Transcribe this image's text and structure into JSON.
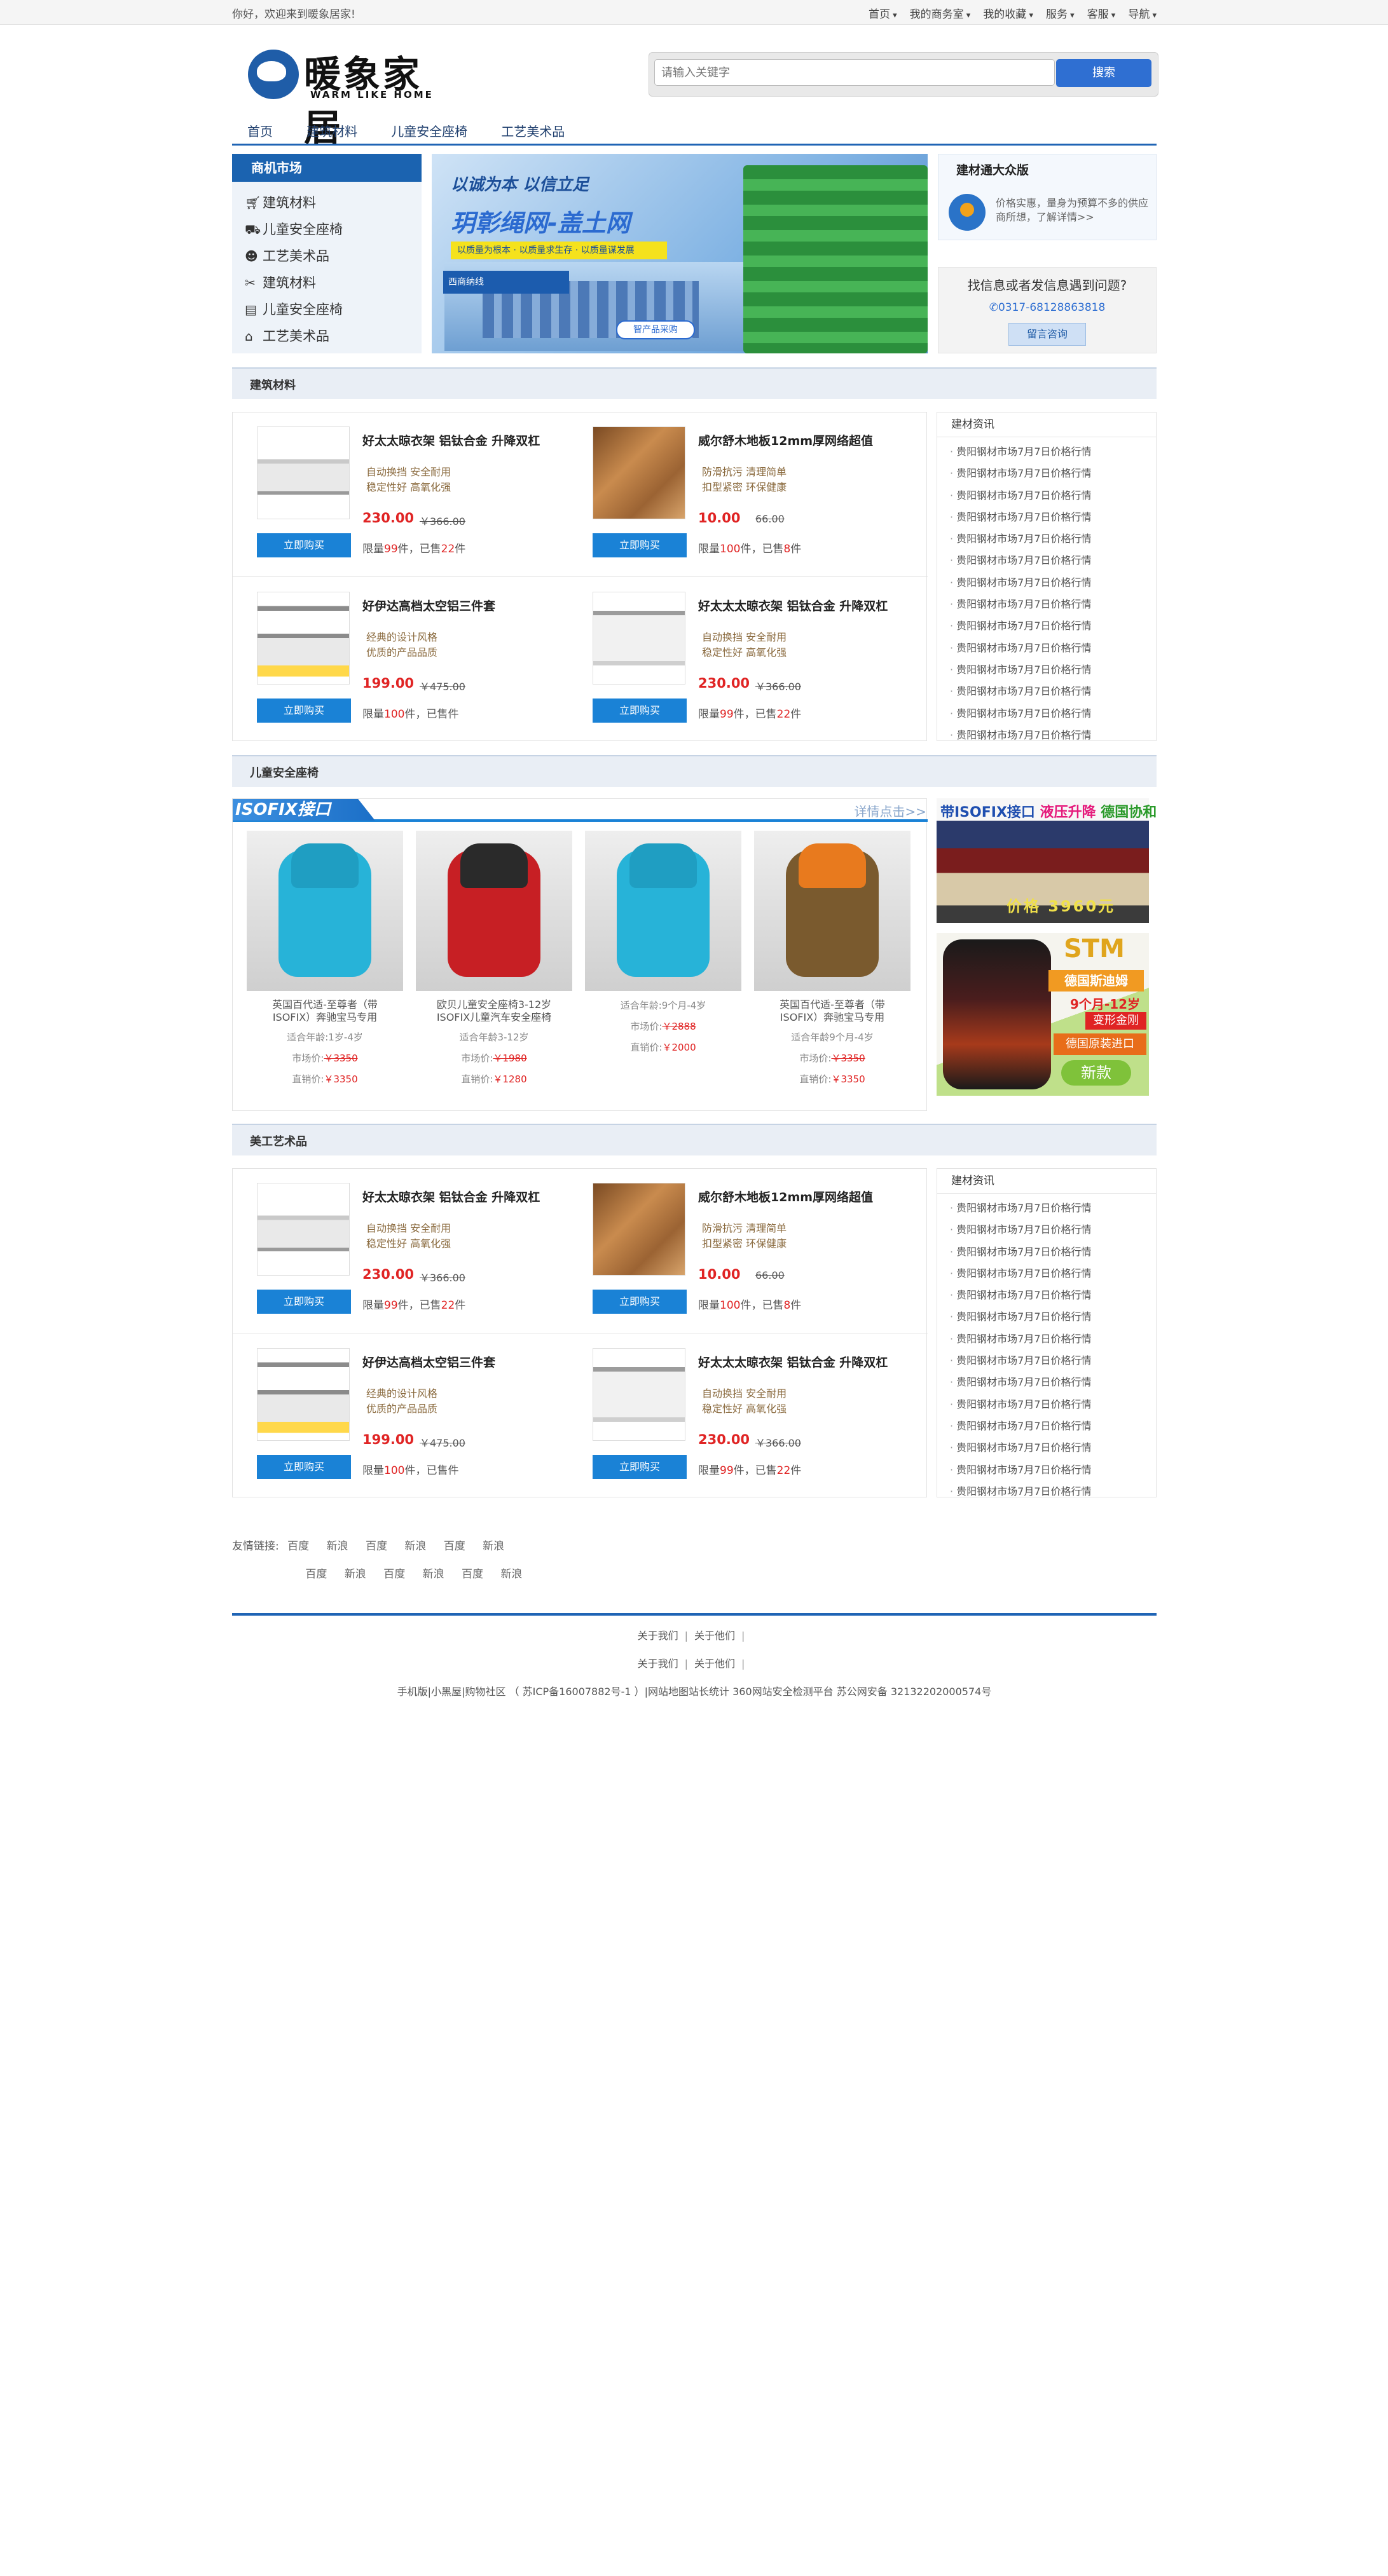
{
  "topbar": {
    "welcome": "你好，欢迎来到暖象居家!",
    "menu": [
      "首页",
      "我的商务室",
      "我的收藏",
      "服务",
      "客服",
      "导航"
    ]
  },
  "logo": {
    "cn": "暖象家居",
    "en": "WARM LIKE HOME"
  },
  "search": {
    "placeholder": "请输入关键字",
    "button": "搜索"
  },
  "nav": [
    "首页",
    "建筑材料",
    "儿童安全座椅",
    "工艺美术品"
  ],
  "categories": {
    "title": "商机市场",
    "items": [
      {
        "icon": "cart-icon",
        "label": "建筑材料"
      },
      {
        "icon": "car-icon",
        "label": "儿童安全座椅"
      },
      {
        "icon": "people-icon",
        "label": "工艺美术品"
      },
      {
        "icon": "tools-icon",
        "label": "建筑材料"
      },
      {
        "icon": "document-icon",
        "label": "儿童安全座椅"
      },
      {
        "icon": "building-icon",
        "label": "工艺美术品"
      }
    ]
  },
  "banner": {
    "slogan": "以诚为本 以信立足",
    "headline": "玥彰绳网-盖土网",
    "tagline": "以质量为根本 · 以质量求生存 · 以质量谋发展",
    "tag": "西商纳线",
    "button": "智产品采购"
  },
  "side": {
    "title": "建材通大众版",
    "desc": "价格实惠，量身为预算不多的供应商所想，了解详情>>",
    "question": "找信息或者发信息遇到问题?",
    "phone": "0317-68128863818",
    "message_button": "留言咨询"
  },
  "sections": {
    "building": "建筑材料",
    "seats": "儿童安全座椅",
    "art": "美工艺术品"
  },
  "products": [
    {
      "name": "好太太晾衣架  铝钛合金  升降双杠",
      "f1": "自动换挡    安全耐用",
      "f2": "稳定性好    高氧化强",
      "price": "230.00",
      "old": "￥366.00",
      "limit_pre": "限量",
      "limit_n": "99",
      "limit_mid": "件，已售",
      "sold": "22",
      "limit_end": "件",
      "buy": "立即购买",
      "img": "rack"
    },
    {
      "name": "威尔舒木地板12mm厚网络超值",
      "f1": "防滑抗污    清理简单",
      "f2": "扣型紧密    环保健康",
      "price": "10.00",
      "old": "66.00",
      "limit_pre": "限量",
      "limit_n": "100",
      "limit_mid": "件，已售",
      "sold": "8",
      "limit_end": "件",
      "buy": "立即购买",
      "img": "floor"
    },
    {
      "name": "好伊达高档太空铝三件套",
      "f1": "经典的设计风格",
      "f2": "优质的产品品质",
      "price": "199.00",
      "old": "￥475.00",
      "limit_pre": "限量",
      "limit_n": "100",
      "limit_mid": "件，已售",
      "sold": "",
      "limit_end": "件",
      "buy": "立即购买",
      "img": "towel"
    },
    {
      "name": "好太太太晾衣架  铝钛合金  升降双杠",
      "f1": "自动换挡    安全耐用",
      "f2": "稳定性好    高氧化强",
      "price": "230.00",
      "old": "￥366.00",
      "limit_pre": "限量",
      "limit_n": "99",
      "limit_mid": "件，已售",
      "sold": "22",
      "limit_end": "件",
      "buy": "立即购买",
      "img": "rack2"
    }
  ],
  "news": {
    "title": "建材资讯",
    "items": [
      "贵阳钢材市场7月7日价格行情",
      "贵阳钢材市场7月7日价格行情",
      "贵阳钢材市场7月7日价格行情",
      "贵阳钢材市场7月7日价格行情",
      "贵阳钢材市场7月7日价格行情",
      "贵阳钢材市场7月7日价格行情",
      "贵阳钢材市场7月7日价格行情",
      "贵阳钢材市场7月7日价格行情",
      "贵阳钢材市场7月7日价格行情",
      "贵阳钢材市场7月7日价格行情",
      "贵阳钢材市场7月7日价格行情",
      "贵阳钢材市场7月7日价格行情",
      "贵阳钢材市场7月7日价格行情",
      "贵阳钢材市场7月7日价格行情"
    ]
  },
  "isofix": {
    "tab": "ISOFIX接口",
    "more": "详情点击>>",
    "seats": [
      {
        "t1": "英国百代适-至尊者（带",
        "t2": "ISOFIX）奔驰宝马专用",
        "age": "适合年龄:1岁-4岁",
        "mkt_label": "市场价:",
        "mkt": "￥3350",
        "dir_label": "直销价:",
        "dir": "￥3350",
        "color": "#27b3d8"
      },
      {
        "t1": "欧贝儿童安全座椅3-12岁",
        "t2": "ISOFIX儿童汽车安全座椅",
        "age": "适合年龄3-12岁",
        "mkt_label": "市场价:",
        "mkt": "￥1980",
        "dir_label": "直销价:",
        "dir": "￥1280",
        "color": "#c71f24"
      },
      {
        "t1": "",
        "t2": "",
        "age": "适合年龄:9个月-4岁",
        "mkt_label": "市场价:",
        "mkt": "￥2888",
        "dir_label": "直销价:",
        "dir": "￥2000",
        "color": "#27b3d8"
      },
      {
        "t1": "英国百代适-至尊者（带",
        "t2": "ISOFIX）奔驰宝马专用",
        "age": "适合年龄9个月-4岁",
        "mkt_label": "市场价:",
        "mkt": "￥3350",
        "dir_label": "直销价:",
        "dir": "￥3350",
        "color": "#7a5a2e"
      }
    ]
  },
  "ads": {
    "ad1": {
      "a": "带ISOFIX接口",
      "b": "液压升降",
      "c": "德国协和",
      "price": "价格 3960元"
    },
    "ad2": {
      "brand": "STM",
      "r1": "德国斯迪姆",
      "r2": "9个月-12岁",
      "r3": "变形金刚",
      "r4": "德国原装进口",
      "r5": "新款"
    }
  },
  "friends": {
    "label": "友情链接:",
    "row1": [
      "百度",
      "新浪",
      "百度",
      "新浪",
      "百度",
      "新浪"
    ],
    "row2": [
      "百度",
      "新浪",
      "百度",
      "新浪",
      "百度",
      "新浪"
    ]
  },
  "footer": {
    "links1": [
      "关于我们",
      "关于他们"
    ],
    "links2": [
      "关于我们",
      "关于他们"
    ],
    "copyright": "手机版|小黑屋|购物社区 （ 苏ICP备16007882号-1 ）|网站地图站长统计 360网站安全检测平台 苏公网安备 32132202000574号"
  }
}
